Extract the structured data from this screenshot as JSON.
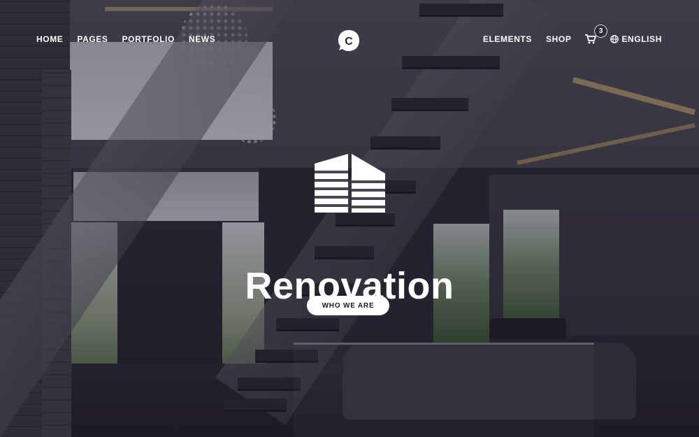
{
  "nav_left": [
    "HOME",
    "PAGES",
    "PORTFOLIO",
    "NEWS"
  ],
  "nav_right": {
    "elements": "ELEMENTS",
    "shop": "SHOP",
    "cart_count": "3",
    "language": "ENGLISH"
  },
  "logo": {
    "letter": "C"
  },
  "hero": {
    "title": "Renovation",
    "button": "WHO WE ARE"
  },
  "icons": {
    "cart": "shopping-cart-icon",
    "language": "globe-icon",
    "hero": "building-icon"
  },
  "colors": {
    "text": "#ffffff",
    "button_bg": "#ffffff",
    "button_text": "#1c1a24"
  }
}
